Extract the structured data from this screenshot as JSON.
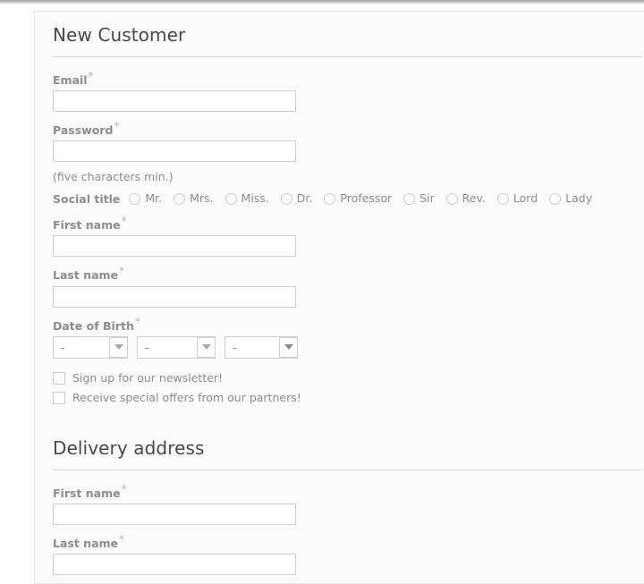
{
  "theme": {
    "card_bg": "#fbfbfb",
    "card_border": "#e4e4e4",
    "heading_color": "#484848",
    "label_color": "#8d8d8d",
    "input_border": "#cfcfcf",
    "rule_color": "#d6d6d6"
  },
  "new_customer": {
    "title": "New Customer",
    "email": {
      "label": "Email",
      "required_mark": "*",
      "value": "",
      "placeholder": ""
    },
    "password": {
      "label": "Password",
      "required_mark": "*",
      "value": "",
      "placeholder": "",
      "hint": "(five characters min.)"
    },
    "social_title": {
      "label": "Social title",
      "options": [
        "Mr.",
        "Mrs.",
        "Miss.",
        "Dr.",
        "Professor",
        "Sir",
        "Rev.",
        "Lord",
        "Lady"
      ],
      "selected": ""
    },
    "first_name": {
      "label": "First name",
      "required_mark": "*",
      "value": "",
      "placeholder": ""
    },
    "last_name": {
      "label": "Last name",
      "required_mark": "*",
      "value": "",
      "placeholder": ""
    },
    "date_of_birth": {
      "label": "Date of Birth",
      "required_mark": "*",
      "day": {
        "value": "-",
        "name": "day"
      },
      "month": {
        "value": "-",
        "name": "month"
      },
      "year": {
        "value": "-",
        "name": "year"
      }
    },
    "checkboxes": [
      {
        "label": "Sign up for our newsletter!",
        "checked": false
      },
      {
        "label": "Receive special offers from our partners!",
        "checked": false
      }
    ]
  },
  "delivery_address": {
    "title": "Delivery address",
    "first_name": {
      "label": "First name",
      "required_mark": "*",
      "value": "",
      "placeholder": ""
    },
    "last_name": {
      "label": "Last name",
      "required_mark": "*",
      "value": "",
      "placeholder": ""
    }
  }
}
